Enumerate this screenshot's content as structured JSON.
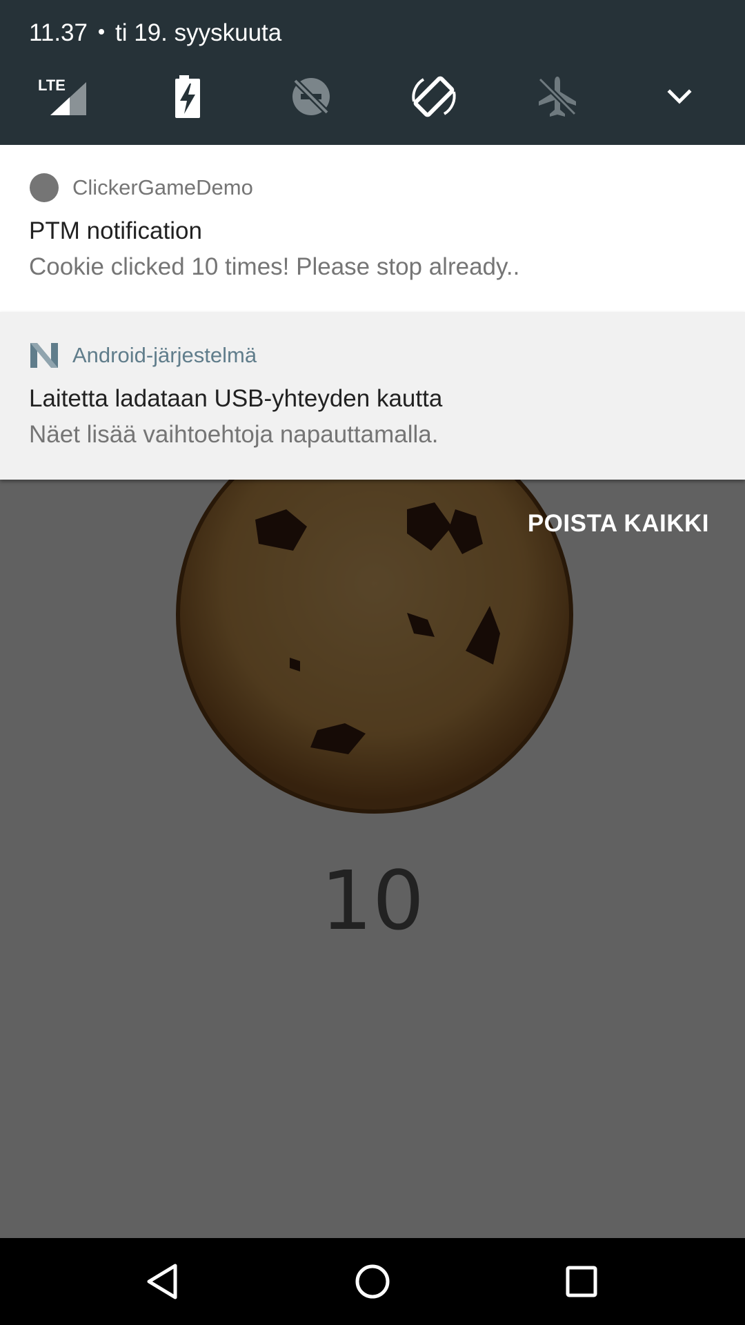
{
  "status": {
    "time": "11.37",
    "date": "ti 19. syyskuuta"
  },
  "quick_settings": {
    "tiles": [
      {
        "icon": "lte-signal-icon",
        "label": "LTE"
      },
      {
        "icon": "battery-charging-icon"
      },
      {
        "icon": "do-not-disturb-off-icon"
      },
      {
        "icon": "auto-rotate-icon"
      },
      {
        "icon": "airplane-mode-off-icon"
      },
      {
        "icon": "expand-chevron-icon"
      }
    ]
  },
  "notifications": [
    {
      "app": "ClickerGameDemo",
      "title": "PTM notification",
      "text": "Cookie clicked 10 times! Please stop already..",
      "icon": "circle-app-icon"
    },
    {
      "app": "Android-järjestelmä",
      "title": "Laitetta ladataan USB-yhteyden kautta",
      "text": "Näet lisää vaihtoehtoja napauttamalla.",
      "icon": "android-n-logo-icon"
    }
  ],
  "clear_all_label": "POISTA KAIKKI",
  "app": {
    "counter": "10",
    "cookie": "cookie-image"
  },
  "navbar": {
    "buttons": [
      "back-icon",
      "home-icon",
      "recents-icon"
    ]
  },
  "colors": {
    "header_bg": "#263238",
    "notification_bg": "#ffffff",
    "system_notification_bg": "#f1f1f1",
    "android_accent": "#607d8b",
    "scrim": "#616161"
  }
}
